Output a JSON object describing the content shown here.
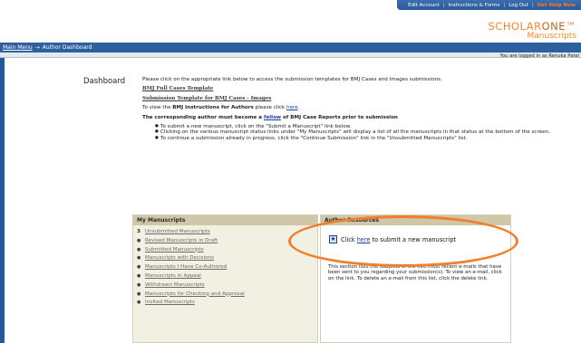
{
  "toplinks": {
    "edit_account": "Edit Account",
    "instructions": "Instructions & Forms",
    "logout": "Log Out",
    "help": "Get Help Now"
  },
  "logo": {
    "scholar": "SCHOLAR",
    "one": "ONE",
    "manuscripts": "Manuscripts"
  },
  "nav": {
    "main_menu": "Main Menu",
    "arrow": "→",
    "current": "Author Dashboard"
  },
  "login_text": "You are logged in as Renuka Patel",
  "dashboard_label": "Dashboard",
  "intro": "Please click on the appropriate link below to access the submission templates for BMJ Cases and Images submissions.",
  "template1": "BMJ Full Cases Template",
  "template2": "Submission Template for BMJ Cases - Images",
  "view_prefix": "To view the",
  "view_bold": "BMJ Instructions for Authors",
  "view_mid": "please click",
  "view_here": "here",
  "view_end": ".",
  "fellow_prefix": "The corresponding author must become a",
  "fellow_link": "fellow",
  "fellow_suffix": "of BMJ Case Reports prior to submission",
  "bullets": [
    "To submit a new manuscript, click on the \"Submit a Manuscript\" link below.",
    "Clicking on the various manuscript status links under \"My Manuscripts\" will display a list of all the manuscripts in that status at the bottom of the screen.",
    "To continue a submission already in progress, click the \"Continue Submission\" link in the \"Unsubmitted Manuscripts\" list."
  ],
  "my_manuscripts": {
    "title": "My Manuscripts",
    "items": [
      {
        "count": "3",
        "label": "Unsubmitted Manuscripts"
      },
      {
        "count": "●",
        "label": "Revised Manuscripts in Draft"
      },
      {
        "count": "●",
        "label": "Submitted Manuscripts"
      },
      {
        "count": "●",
        "label": "Manuscripts with Decisions"
      },
      {
        "count": "●",
        "label": "Manuscripts I Have Co-Authored"
      },
      {
        "count": "●",
        "label": "Manuscripts in Appeal"
      },
      {
        "count": "●",
        "label": "Withdrawn Manuscripts"
      },
      {
        "count": "●",
        "label": "Manuscripts for Checking and Approval"
      },
      {
        "count": "●",
        "label": "Invited Manuscripts"
      }
    ]
  },
  "author_resources": {
    "title": "Author Resources",
    "submit_prefix": "Click",
    "submit_here": "here",
    "submit_suffix": "to submit a new manuscript",
    "description": "This section lists the subjects of the five most recent e-mails that have been sent to you regarding your submission(s). To view an e-mail, click on the link. To delete an e-mail from this list, click the delete link."
  },
  "colors": {
    "accent_orange": "#ef7f2a",
    "nav_blue": "#2e5f9e",
    "box_header": "#cfc7a8"
  }
}
